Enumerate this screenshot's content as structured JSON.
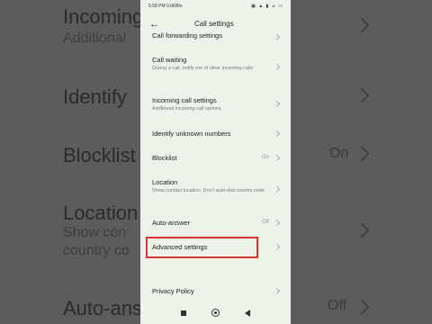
{
  "background": {
    "items": [
      {
        "label": "Incoming",
        "sub": "Additional"
      },
      {
        "label": "Identify"
      },
      {
        "label": "Blocklist",
        "value": "On"
      },
      {
        "label": "Location",
        "sub": "Show con",
        "sub2": "country co"
      },
      {
        "label": "Auto-ans",
        "value": "Off"
      }
    ]
  },
  "status": {
    "time": "5:58 PM",
    "speed": "0.0KB/s",
    "icons": "▣ ▲ ▮ ⊿ ▭"
  },
  "header": {
    "title": "Call settings"
  },
  "items": [
    {
      "label": "Call forwarding settings"
    },
    {
      "label": "Call waiting",
      "sub": "During a call, notify me of other incoming calls"
    },
    {
      "label": "Incoming call settings",
      "sub": "Additional incoming call options"
    },
    {
      "label": "Identify unknown numbers"
    },
    {
      "label": "Blocklist",
      "value": "On"
    },
    {
      "label": "Location",
      "sub": "Show contact location. Don't auto-dial country code"
    },
    {
      "label": "Auto-answer",
      "value": "Off"
    },
    {
      "label": "Advanced settings"
    },
    {
      "label": "Privacy Policy"
    }
  ],
  "colors": {
    "highlight": "#d93535",
    "screen_bg": "#eef3e9"
  }
}
